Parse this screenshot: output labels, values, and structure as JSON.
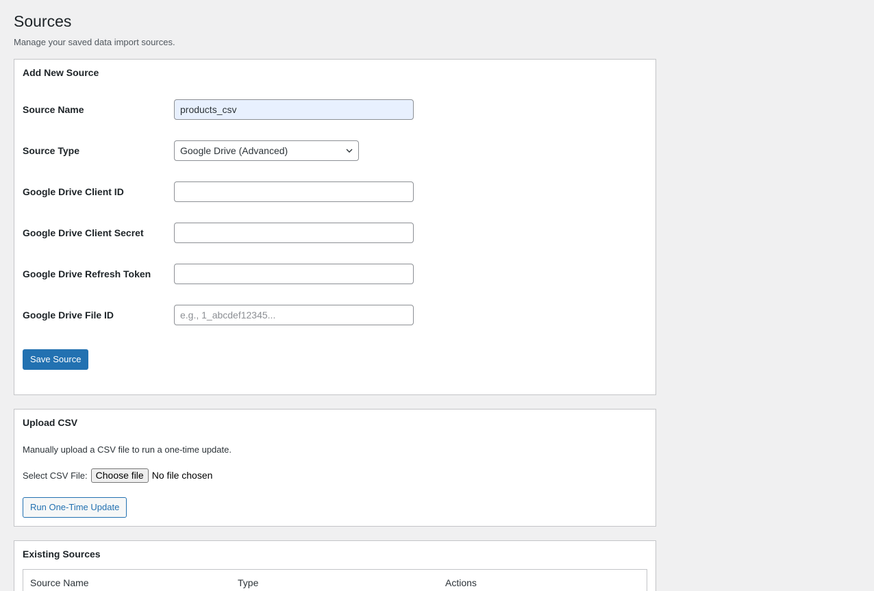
{
  "page": {
    "title": "Sources",
    "description": "Manage your saved data import sources."
  },
  "add_source": {
    "title": "Add New Source",
    "fields": {
      "source_name": {
        "label": "Source Name",
        "value": "products_csv"
      },
      "source_type": {
        "label": "Source Type",
        "value": "Google Drive (Advanced)"
      },
      "client_id": {
        "label": "Google Drive Client ID",
        "value": ""
      },
      "client_secret": {
        "label": "Google Drive Client Secret",
        "value": ""
      },
      "refresh_token": {
        "label": "Google Drive Refresh Token",
        "value": ""
      },
      "file_id": {
        "label": "Google Drive File ID",
        "value": "",
        "placeholder": "e.g., 1_abcdef12345..."
      }
    },
    "save_label": "Save Source"
  },
  "upload": {
    "title": "Upload CSV",
    "description": "Manually upload a CSV file to run a one-time update.",
    "file_label": "Select CSV File:",
    "choose_label": "Choose file",
    "file_status": "No file chosen",
    "run_label": "Run One-Time Update"
  },
  "existing": {
    "title": "Existing Sources",
    "columns": [
      "Source Name",
      "Type",
      "Actions"
    ]
  },
  "colors": {
    "primary": "#2271b1",
    "background": "#f0f0f1",
    "autofill": "#e8f0fe"
  },
  "icons": {
    "select_caret": "chevron-down-icon"
  }
}
